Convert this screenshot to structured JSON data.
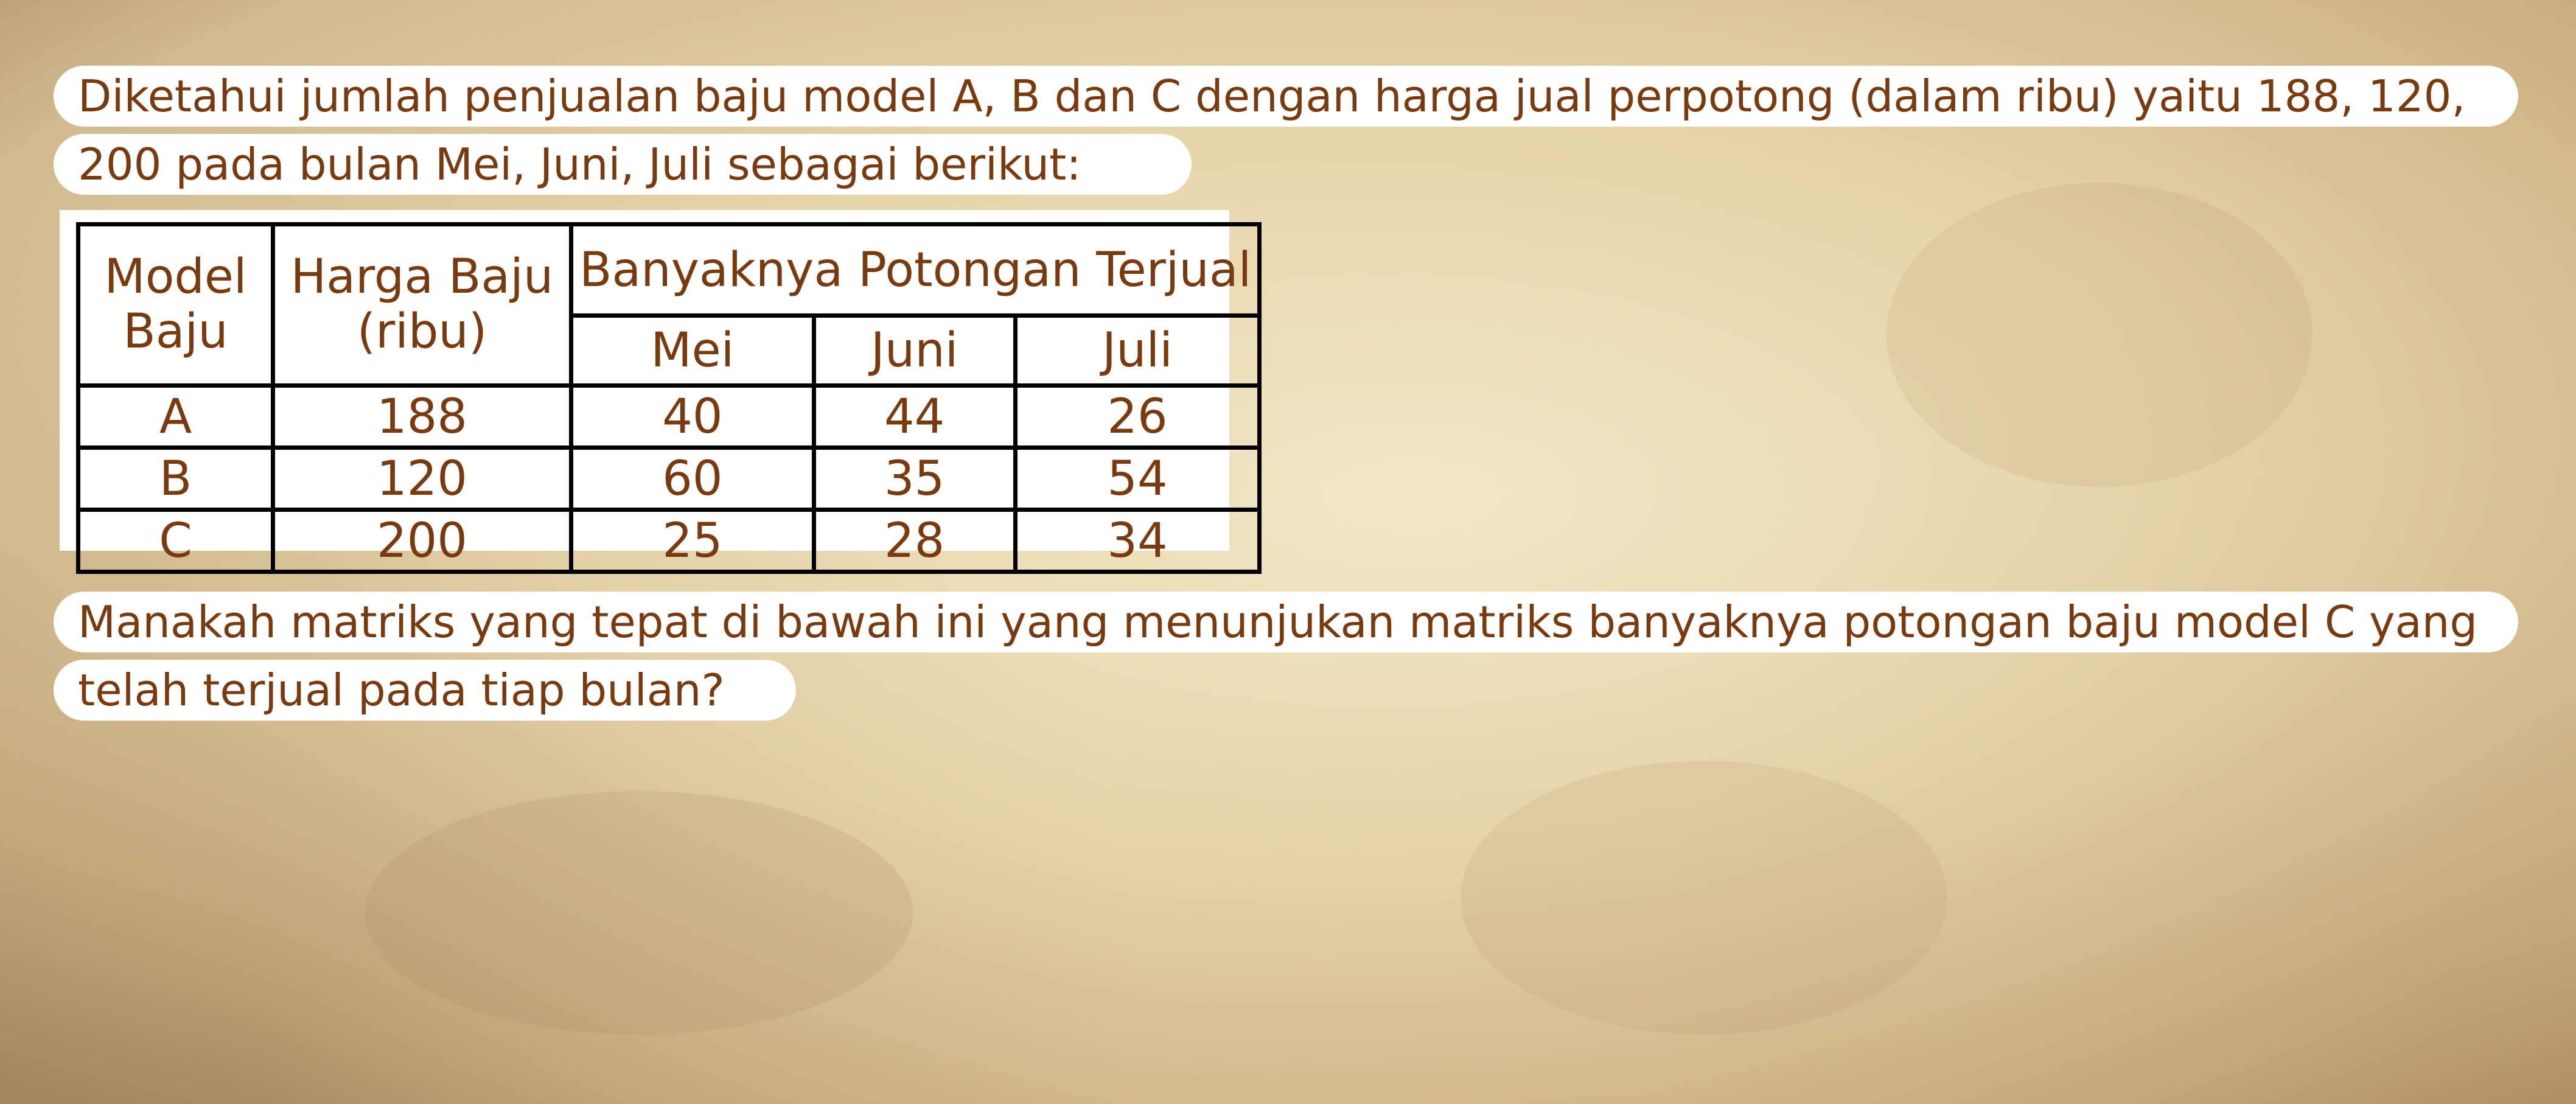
{
  "question": {
    "line1": "Diketahui jumlah penjualan baju model A, B dan C dengan harga jual perpotong (dalam ribu) yaitu 188, 120,",
    "line2": "200 pada bulan Mei, Juni, Juli sebagai berikut:",
    "line3": "Manakah matriks yang tepat di bawah ini yang menunjukan matriks banyaknya potongan baju model C yang",
    "line4": "telah terjual pada tiap bulan?"
  },
  "table": {
    "header": {
      "model_line1": "Model",
      "model_line2": "Baju",
      "harga_line1": "Harga Baju",
      "harga_line2": "(ribu)",
      "group": "Banyaknya Potongan Terjual",
      "months": [
        "Mei",
        "Juni",
        "Juli"
      ]
    },
    "rows": [
      {
        "model": "A",
        "harga": "188",
        "mei": "40",
        "juni": "44",
        "juli": "26"
      },
      {
        "model": "B",
        "harga": "120",
        "mei": "60",
        "juni": "35",
        "juli": "54"
      },
      {
        "model": "C",
        "harga": "200",
        "mei": "25",
        "juni": "28",
        "juli": "34"
      }
    ]
  },
  "colors": {
    "text": "#7a3a10",
    "border": "#000000",
    "pill_background": "#ffffff"
  }
}
